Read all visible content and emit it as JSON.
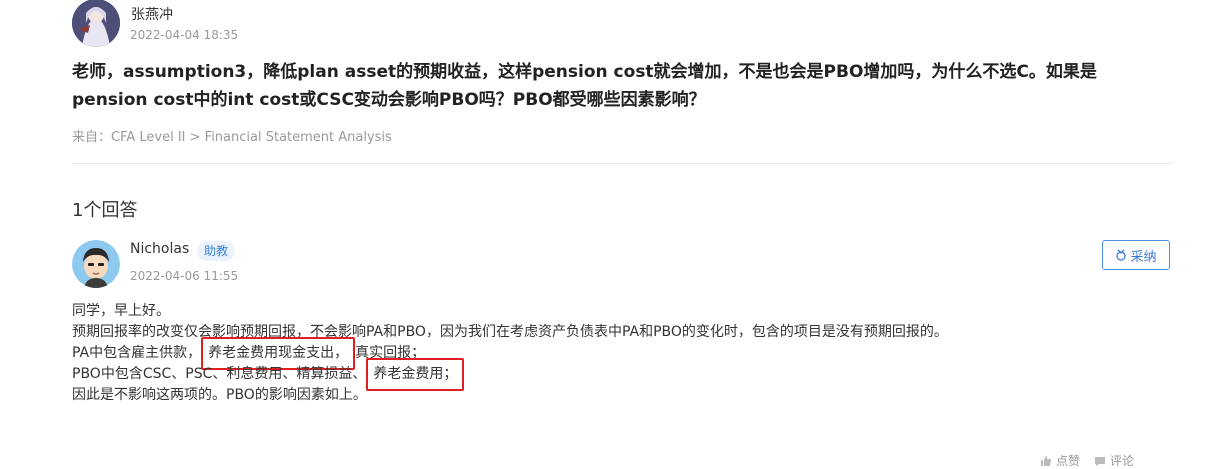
{
  "question": {
    "author": "张燕冲",
    "time": "2022-04-04 18:35",
    "title": "老师，assumption3，降低plan asset的预期收益，这样pension cost就会增加，不是也会是PBO增加吗，为什么不选C。如果是pension cost中的int cost或CSC变动会影响PBO吗？PBO都受哪些因素影响？",
    "source": "来自：CFA Level II > Financial Statement Analysis"
  },
  "answers_count": "1个回答",
  "answer": {
    "author": "Nicholas",
    "role_badge": "助教",
    "time": "2022-04-06 11:55",
    "accept_label": "采纳",
    "line1": "同学，早上好。",
    "line2": "预期回报率的改变仅会影响预期回报，不会影响PA和PBO，因为我们在考虑资产负债表中PA和PBO的变化时，包含的项目是没有预期回报的。",
    "line3_pre": "PA中包含雇主供款，",
    "line3_hl": "养老金费用现金支出，",
    "line3_post": "真实回报；",
    "line4_pre": "PBO中包含CSC、PSC、利息费用、精算损益、",
    "line4_hl": "养老金费用；",
    "line5": "因此是不影响这两项的。PBO的影响因素如上。"
  },
  "footer": {
    "like": "点赞",
    "comment": "评论"
  },
  "colors": {
    "accent": "#4a90e2",
    "highlight_box": "#e02020"
  }
}
